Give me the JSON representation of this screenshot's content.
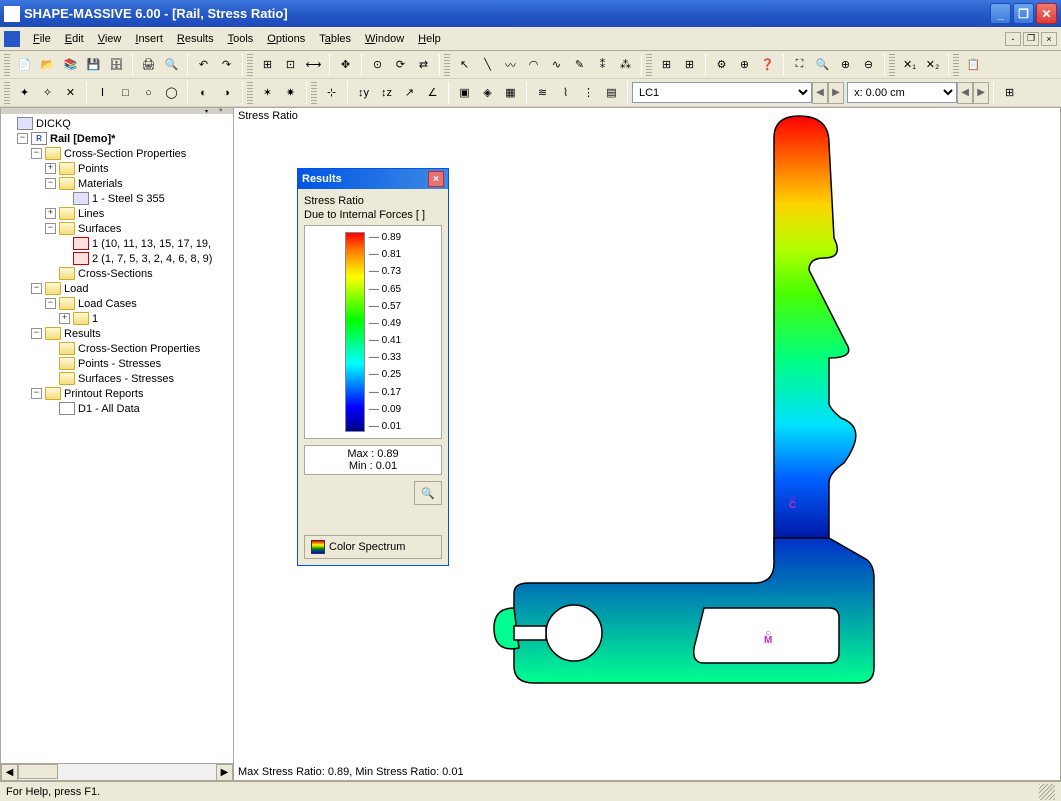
{
  "titlebar": {
    "text": "SHAPE-MASSIVE 6.00 - [Rail, Stress Ratio]"
  },
  "menu": {
    "items": [
      "File",
      "Edit",
      "View",
      "Insert",
      "Results",
      "Tools",
      "Options",
      "Tables",
      "Window",
      "Help"
    ]
  },
  "toolbar2": {
    "combo_lc": "LC1",
    "combo_x": "x: 0.00 cm"
  },
  "tree": {
    "root": "DICKQ",
    "project": "Rail [Demo]*",
    "csp": "Cross-Section Properties",
    "points": "Points",
    "materials": "Materials",
    "steel": "1 - Steel S 355",
    "lines": "Lines",
    "surfaces": "Surfaces",
    "surf1": "1 (10, 11, 13, 15, 17, 19,",
    "surf2": "2 (1, 7, 5, 3, 2, 4, 6, 8, 9)",
    "cross_sections": "Cross-Sections",
    "load": "Load",
    "load_cases": "Load Cases",
    "lc1": "1",
    "results": "Results",
    "res_csp": "Cross-Section Properties",
    "res_points": "Points - Stresses",
    "res_surfaces": "Surfaces - Stresses",
    "printout": "Printout Reports",
    "d1": "D1 - All Data"
  },
  "viewport": {
    "title": "Stress Ratio",
    "footer": "Max Stress Ratio: 0.89, Min Stress Ratio: 0.01",
    "marker_c": "C",
    "marker_m": "M"
  },
  "results_panel": {
    "title": "Results",
    "label1": "Stress Ratio",
    "label2": "Due to Internal Forces  [ ]",
    "ticks": [
      "0.89",
      "0.81",
      "0.73",
      "0.65",
      "0.57",
      "0.49",
      "0.41",
      "0.33",
      "0.25",
      "0.17",
      "0.09",
      "0.01"
    ],
    "max": "Max  : 0.89",
    "min": "Min  : 0.01",
    "spectrum_btn": "Color Spectrum"
  },
  "statusbar": {
    "text": "For Help, press F1."
  }
}
